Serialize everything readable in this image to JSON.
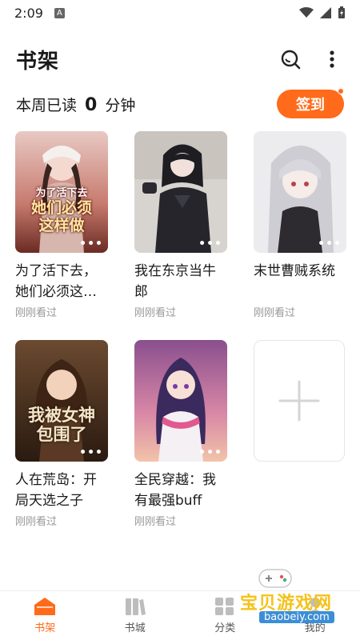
{
  "status": {
    "time": "2:09",
    "badge": "A"
  },
  "header": {
    "title": "书架"
  },
  "reading": {
    "prefix": "本周已读",
    "count": "0",
    "suffix": "分钟"
  },
  "checkin": {
    "label": "签到"
  },
  "books": [
    {
      "title": "为了活下去，她们必须这…",
      "status": "刚刚看过",
      "cover_text": "为了活下去 她们必须这样做"
    },
    {
      "title": "我在东京当牛郎",
      "status": "刚刚看过"
    },
    {
      "title": "末世曹贼系统",
      "status": "刚刚看过"
    },
    {
      "title": "人在荒岛：开局天选之子",
      "status": "刚刚看过",
      "cover_text": "我被女神包围了"
    },
    {
      "title": "全民穿越：我有最强buff",
      "status": "刚刚看过"
    }
  ],
  "more_dots": "•••",
  "tabs": [
    {
      "label": "书架",
      "icon": "home-icon",
      "active": true
    },
    {
      "label": "书城",
      "icon": "books-icon",
      "active": false
    },
    {
      "label": "分类",
      "icon": "grid-icon",
      "active": false
    },
    {
      "label": "我的",
      "icon": "user-icon",
      "active": false
    }
  ],
  "watermark": {
    "text": "宝贝游戏网",
    "url": "baobeiy.com"
  },
  "colors": {
    "accent": "#ff6b1a",
    "muted": "#999999"
  }
}
